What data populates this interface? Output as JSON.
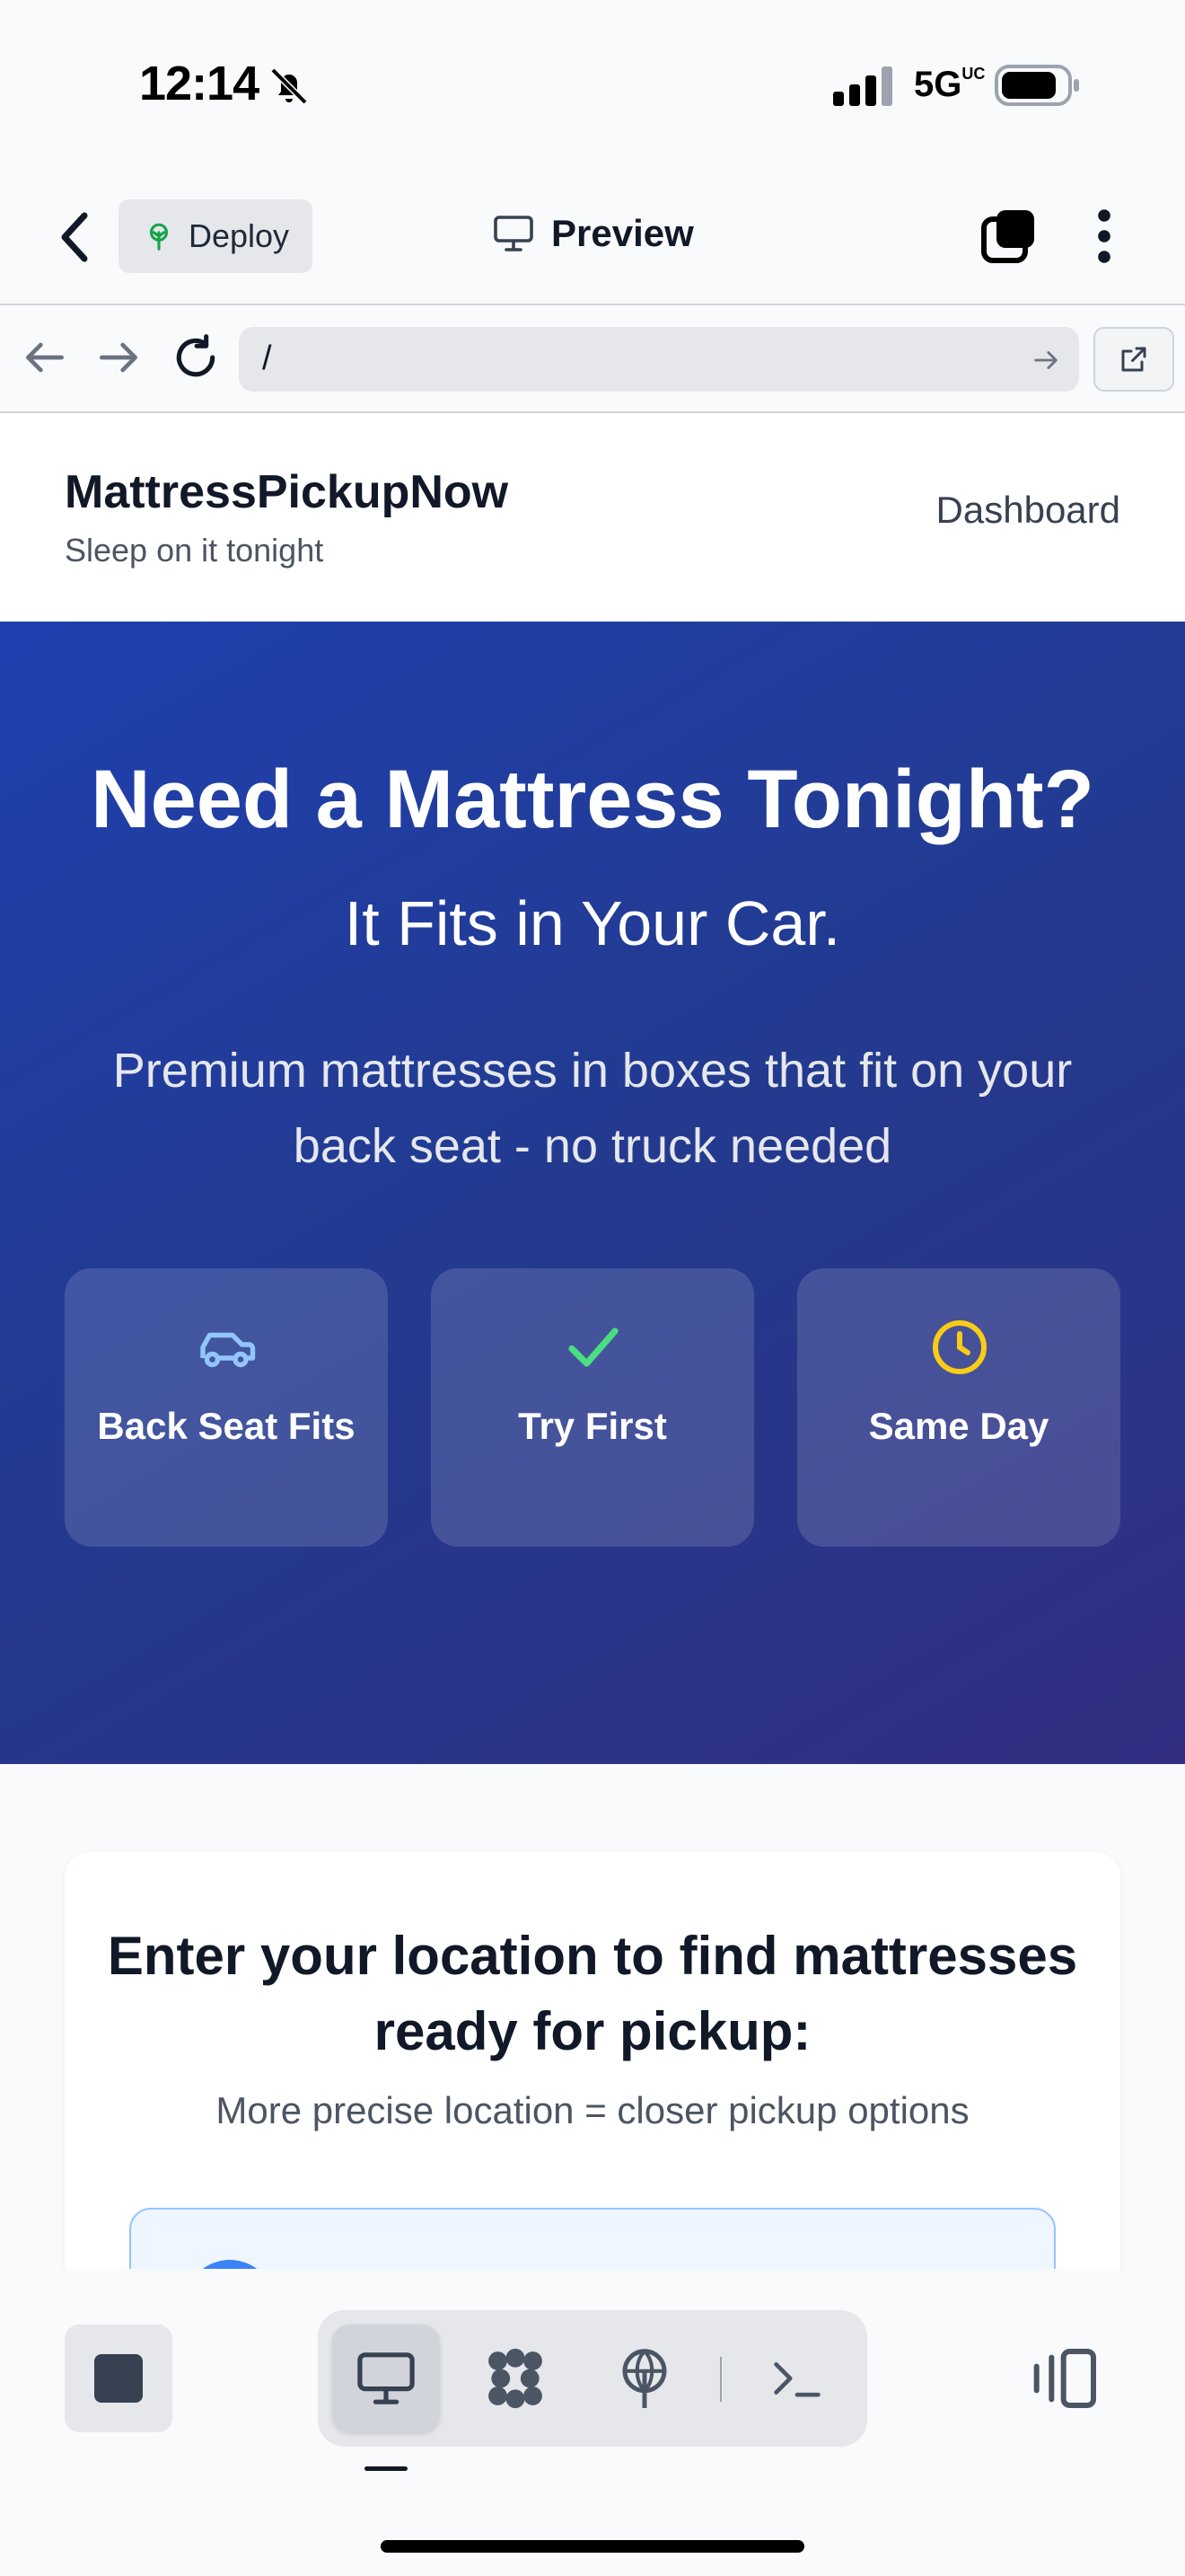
{
  "status_bar": {
    "time": "12:14",
    "network": "5G",
    "network_suffix": "UC"
  },
  "app_bar": {
    "deploy_label": "Deploy",
    "preview_label": "Preview"
  },
  "url_bar": {
    "url": "/"
  },
  "site_header": {
    "brand": "MattressPickupNow",
    "tagline": "Sleep on it tonight",
    "dashboard_link": "Dashboard"
  },
  "hero": {
    "title": "Need a Mattress Tonight?",
    "subtitle": "It Fits in Your Car.",
    "description": "Premium mattresses in boxes that fit on your back seat - no truck needed",
    "features": [
      {
        "icon": "car-icon",
        "label": "Back Seat Fits",
        "color": "#93c5fd"
      },
      {
        "icon": "check-icon",
        "label": "Try First",
        "color": "#4ade80"
      },
      {
        "icon": "clock-icon",
        "label": "Same Day",
        "color": "#facc15"
      }
    ]
  },
  "location": {
    "title": "Enter your location to find mattresses ready for pickup:",
    "hint": "More precise location = closer pickup options"
  },
  "colors": {
    "hero_start": "#1e40af",
    "hero_end": "#312e81",
    "accent": "#3b82f6"
  }
}
